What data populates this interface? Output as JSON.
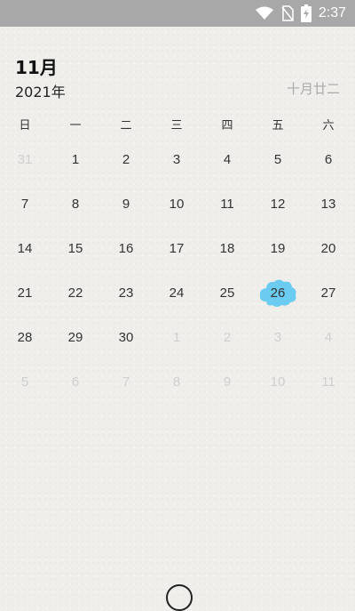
{
  "status_bar": {
    "time": "2:37",
    "icons": [
      "wifi-icon",
      "no-sim-icon",
      "battery-charging-icon"
    ]
  },
  "header": {
    "month": "11月",
    "year": "2021年",
    "lunar": "十月廿二"
  },
  "weekdays": [
    "日",
    "一",
    "二",
    "三",
    "四",
    "五",
    "六"
  ],
  "weeks": [
    [
      "31",
      "1",
      "2",
      "3",
      "4",
      "5",
      "6"
    ],
    [
      "7",
      "8",
      "9",
      "10",
      "11",
      "12",
      "13"
    ],
    [
      "14",
      "15",
      "16",
      "17",
      "18",
      "19",
      "20"
    ],
    [
      "21",
      "22",
      "23",
      "24",
      "25",
      "26",
      "27"
    ],
    [
      "28",
      "29",
      "30",
      "1",
      "2",
      "3",
      "4"
    ],
    [
      "5",
      "6",
      "7",
      "8",
      "9",
      "10",
      "11"
    ]
  ],
  "muted_days": [
    [
      0,
      0
    ],
    [
      4,
      3
    ],
    [
      4,
      4
    ],
    [
      4,
      5
    ],
    [
      4,
      6
    ],
    [
      5,
      0
    ],
    [
      5,
      1
    ],
    [
      5,
      2
    ],
    [
      5,
      3
    ],
    [
      5,
      4
    ],
    [
      5,
      5
    ],
    [
      5,
      6
    ]
  ],
  "today": {
    "week": 3,
    "day": 5,
    "highlight_color": "#6ccbf0"
  }
}
